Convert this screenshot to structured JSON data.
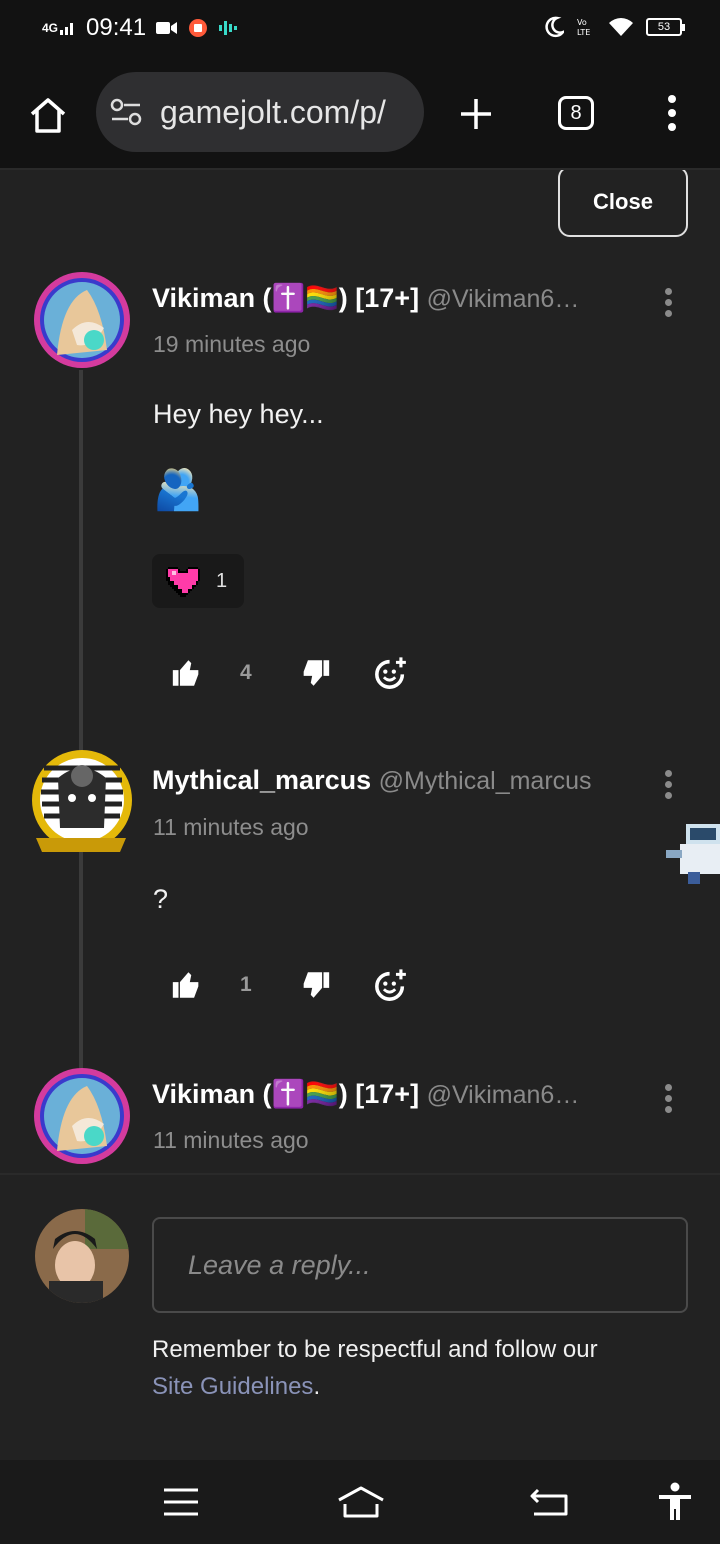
{
  "status_bar": {
    "time": "09:41",
    "network": "4G",
    "battery": "53"
  },
  "browser": {
    "url": "gamejolt.com/p/",
    "tab_count": "8"
  },
  "close_label": "Close",
  "comments": [
    {
      "name": "Vikiman (✝️🏳️‍🌈) [17+]",
      "handle": "@Vikiman6…",
      "time": "19 minutes ago",
      "text": "Hey hey hey...",
      "emoji": "🫂",
      "reaction_count": "1",
      "likes": "4"
    },
    {
      "name": "Mythical_marcus",
      "handle": "@Mythical_marcus",
      "time": "11 minutes ago",
      "text": "?",
      "likes": "1"
    },
    {
      "name": "Vikiman (✝️🏳️‍🌈) [17+]",
      "handle": "@Vikiman6…",
      "time": "11 minutes ago"
    }
  ],
  "reply": {
    "placeholder": "Leave a reply...",
    "notice": "Remember to be respectful and follow our",
    "link": "Site Guidelines",
    "period": "."
  }
}
